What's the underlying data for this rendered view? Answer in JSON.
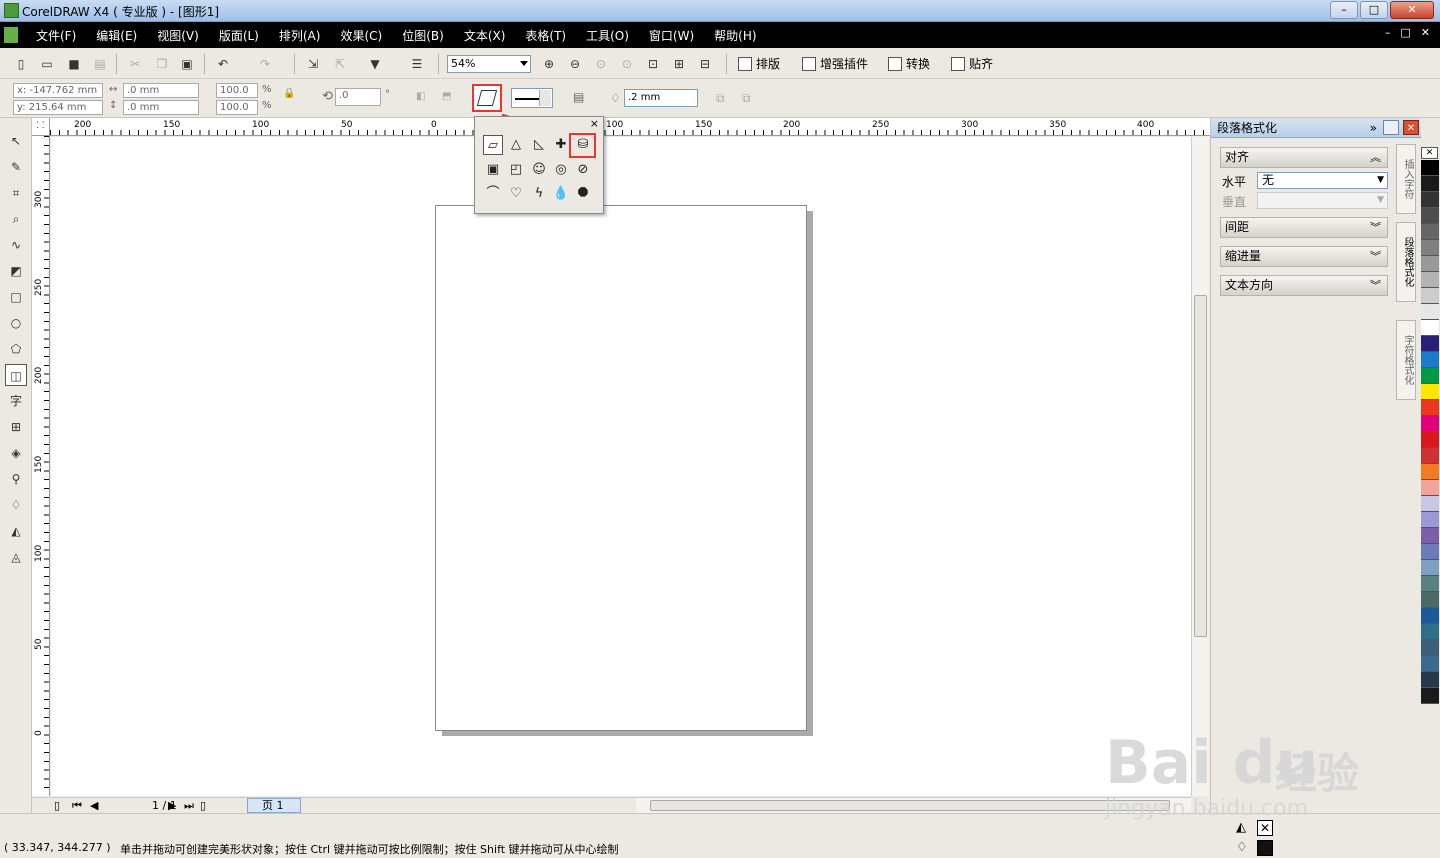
{
  "window": {
    "title": "CorelDRAW X4 ( 专业版 ) - [图形1]"
  },
  "menu": [
    "文件(F)",
    "编辑(E)",
    "视图(V)",
    "版面(L)",
    "排列(A)",
    "效果(C)",
    "位图(B)",
    "文本(X)",
    "表格(T)",
    "工具(O)",
    "窗口(W)",
    "帮助(H)"
  ],
  "toolbar": {
    "zoom": "54%",
    "buttons": [
      "排版",
      "增强插件",
      "转换",
      "贴齐"
    ]
  },
  "property_bar": {
    "x": "x: -147.762 mm",
    "y": "y: 215.64 mm",
    "width": ".0 mm",
    "height": ".0 mm",
    "scale_x": "100.0",
    "scale_y": "100.0",
    "percent": "%",
    "angle": ".0",
    "outline_width": ".2 mm"
  },
  "ruler": {
    "h_ticks": [
      "200",
      "150",
      "100",
      "50",
      "0",
      "100",
      "150",
      "200",
      "250",
      "300",
      "350",
      "400"
    ],
    "v_ticks": [
      "300",
      "250",
      "200",
      "150",
      "100",
      "50",
      "0"
    ]
  },
  "flyout": {
    "close": "×",
    "shapes": [
      "parallelogram-icon",
      "triangle-icon",
      "right-triangle-icon",
      "cross-icon",
      "cylinder-icon",
      "frame-icon",
      "folded-corner-icon",
      "smiley-icon",
      "donut-icon",
      "no-symbol-icon",
      "arc-icon",
      "heart-icon",
      "lightning-icon",
      "teardrop-icon",
      "octagon-icon"
    ]
  },
  "docker": {
    "title": "段落格式化",
    "sections": {
      "align": "对齐",
      "horizontal_label": "水平",
      "horizontal_value": "无",
      "vertical_label": "垂直",
      "spacing": "间距",
      "indent": "缩进量",
      "text_direction": "文本方向"
    },
    "tabs": [
      "插入字符",
      "段落格式化",
      "字符格式化"
    ]
  },
  "pagebar": {
    "page_count": "1 / 1",
    "page_tab": "页 1"
  },
  "status": {
    "coords": "( 33.347, 344.277 )",
    "hint": "单击并拖动可创建完美形状对象；按住 Ctrl 键并拖动可按比例限制；按住 Shift 键并拖动可从中心绘制"
  },
  "palette": [
    "#000000",
    "#1a1a1a",
    "#333333",
    "#4d4d4d",
    "#666666",
    "#808080",
    "#999999",
    "#b3b3b3",
    "#cccccc",
    "#e6e6e6",
    "#ffffff",
    "#2b1f7a",
    "#1a7acc",
    "#009944",
    "#ffe600",
    "#e83820",
    "#e2007a",
    "#d7191c",
    "#cc3333",
    "#f47920",
    "#f4a39a",
    "#c8c8e6",
    "#9a9ad6",
    "#7d5fa8",
    "#6a7db8",
    "#7fa0c0",
    "#5a8080",
    "#4a6a6a",
    "#1a5a9a",
    "#2e6f8a",
    "#3a5f7a",
    "#3c6a8c",
    "#243a4a",
    "#1a1a1a"
  ],
  "watermark": {
    "brand": "Bai du",
    "tag": "经验",
    "url": "jingyan.baidu.com"
  }
}
